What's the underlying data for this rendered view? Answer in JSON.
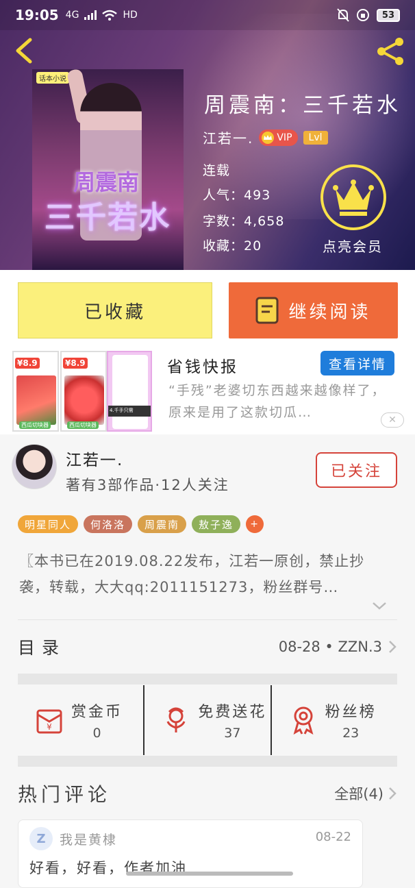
{
  "colors": {
    "accent_orange": "#ef6a3a",
    "fav_yellow": "#fbf07c",
    "follow_red": "#d5433a",
    "vip_gold": "#f9e14a",
    "ad_blue": "#1f7ddb"
  },
  "status_bar": {
    "time": "19:05",
    "network": "4G",
    "hd": "HD",
    "battery": "53"
  },
  "book": {
    "cover_badge": "话本小说",
    "cover_line1": "周震南",
    "cover_line2": "三千若水",
    "title": "周震南：三千若水",
    "author": "江若一.",
    "vip_label": "VIP",
    "level_label": "Lvl",
    "status": "连载",
    "popularity_label": "人气：",
    "popularity": "493",
    "words_label": "字数：",
    "words": "4,658",
    "favorites_label": "收藏：",
    "favorites": "20",
    "vip_action": "点亮会员"
  },
  "actions": {
    "favorited": "已收藏",
    "continue_reading": "继续阅读"
  },
  "ad": {
    "price1": "¥8.9",
    "price2": "¥8.9",
    "pic_label": "西瓜切块器",
    "phone_bar": "4.千手只需",
    "title": "省钱快报",
    "button": "查看详情",
    "description": "“手残”老婆切东西越来越像样了，原来是用了这款切瓜…",
    "close": "✕"
  },
  "author_box": {
    "name": "江若一.",
    "stats": "著有3部作品·12人关注",
    "follow_label": "已关注"
  },
  "tags": [
    {
      "label": "明星同人",
      "color": "#f0a63a"
    },
    {
      "label": "何洛洛",
      "color": "#c9755e"
    },
    {
      "label": "周震南",
      "color": "#d9a04a"
    },
    {
      "label": "敖子逸",
      "color": "#8fb05a"
    }
  ],
  "tag_more": "+",
  "intro": "〖本书已在2019.08.22发布，江若一原创，禁止抄袭，转载，大大qq:2011151273，粉丝群号…",
  "toc": {
    "label": "目录",
    "latest": "08-28 • ZZN.3"
  },
  "stats": [
    {
      "label": "赏金币",
      "value": "0",
      "icon": "red-envelope-icon"
    },
    {
      "label": "免费送花",
      "value": "37",
      "icon": "flower-icon"
    },
    {
      "label": "粉丝榜",
      "value": "23",
      "icon": "medal-icon"
    }
  ],
  "hot_comments": {
    "label": "热门评论",
    "all": "全部(4)"
  },
  "comment": {
    "avatar_letter": "Z",
    "user": "我是黄棣",
    "date": "08-22",
    "text": "好看，好看，作者加油"
  }
}
